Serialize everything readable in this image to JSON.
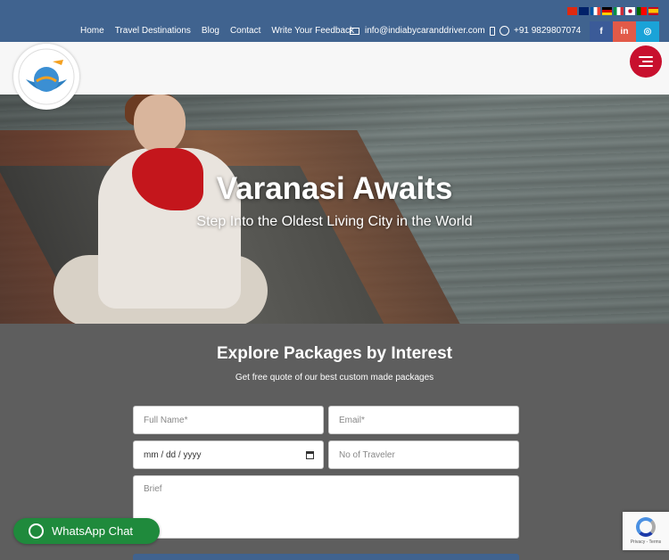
{
  "nav": {
    "items": [
      "Home",
      "Travel Destinations",
      "Blog",
      "Contact",
      "Write Your Feedback"
    ]
  },
  "contact": {
    "email": "info@indiabycaranddriver.com",
    "phone": "+91 9829807074"
  },
  "social": {
    "facebook": "f",
    "linkedin": "in",
    "instagram": "◎"
  },
  "flags": [
    "#de2910",
    "#012169",
    "#0055a4",
    "#000000",
    "#009246",
    "#bc002d",
    "#006600",
    "#c60b1e"
  ],
  "hero": {
    "title": "Varanasi Awaits",
    "subtitle": "Step Into the Oldest Living City in the World"
  },
  "form": {
    "title": "Explore Packages by Interest",
    "subtitle": "Get free quote of our best custom made packages",
    "full_name_placeholder": "Full Name*",
    "email_placeholder": "Email*",
    "date_placeholder": "mm / dd / yyyy",
    "travelers_placeholder": "No of Traveler",
    "brief_placeholder": "Brief"
  },
  "whatsapp": {
    "label": "WhatsApp Chat"
  },
  "recaptcha": {
    "label": "Privacy - Terms"
  }
}
